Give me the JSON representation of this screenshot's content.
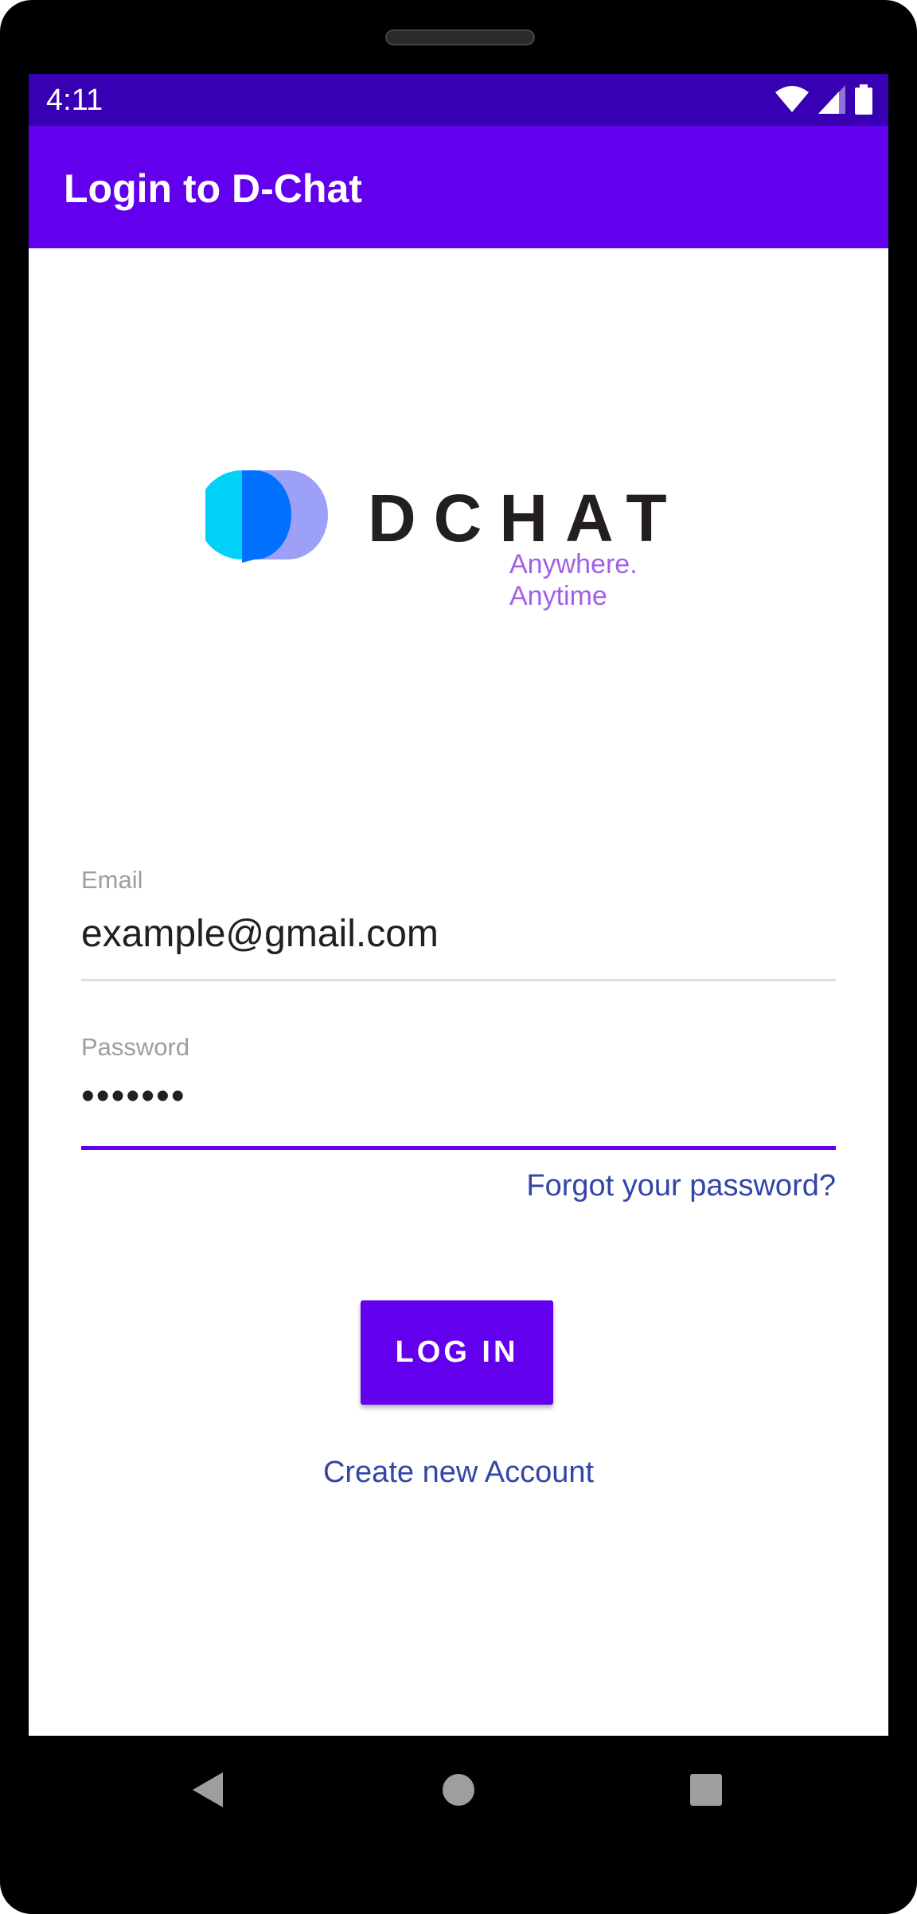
{
  "status_bar": {
    "time": "4:11",
    "icons": [
      "wifi-icon",
      "signal-icon",
      "battery-icon"
    ]
  },
  "app_bar": {
    "title": "Login to D-Chat"
  },
  "logo": {
    "wordmark": "DCHAT",
    "tagline": "Anywhere. Anytime"
  },
  "form": {
    "email": {
      "label": "Email",
      "value": "example@gmail.com"
    },
    "password": {
      "label": "Password",
      "value": "•••••••"
    },
    "forgot_link": "Forgot your password?",
    "login_label": "LOG IN",
    "create_account_link": "Create new Account"
  },
  "nav_bar": {
    "icons": [
      "back-icon",
      "home-icon",
      "recents-icon"
    ]
  },
  "colors": {
    "status_bar": "#3700b3",
    "primary": "#6200ee",
    "link": "#3245a8",
    "tagline": "#a060e8"
  }
}
